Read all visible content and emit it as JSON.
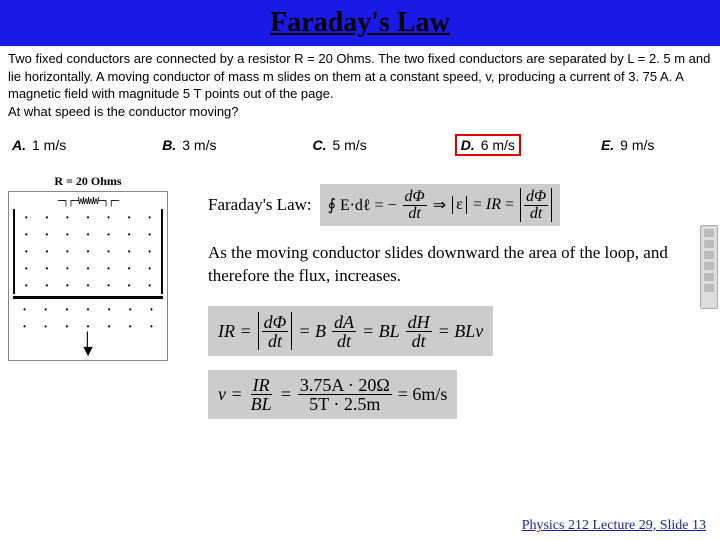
{
  "title": "Faraday's Law",
  "problem": {
    "p1": "Two fixed conductors are connected by a resistor R = 20 Ohms.  The two fixed conductors are separated by L = 2. 5 m and lie horizontally.  A moving conductor of mass m slides on them at a constant speed, v, producing a current of 3. 75 A.  A magnetic field with magnitude 5 T points out of the page.",
    "p2": "At what speed is the conductor moving?"
  },
  "answers": {
    "a": {
      "lbl": "A.",
      "txt": "1 m/s"
    },
    "b": {
      "lbl": "B.",
      "txt": "3 m/s"
    },
    "c": {
      "lbl": "C.",
      "txt": "5 m/s"
    },
    "d": {
      "lbl": "D.",
      "txt": "6 m/s"
    },
    "e": {
      "lbl": "E.",
      "txt": "9 m/s"
    }
  },
  "diagram": {
    "rlabel": "R = 20 Ohms"
  },
  "faraday": {
    "label": "Faraday's Law:",
    "eq1_lhs": "∮ E⋅dℓ = −",
    "eq1_num": "dΦ",
    "eq1_den": "dt",
    "eq1_arrow": "⇒",
    "eq1_rhs1": "|ε| = IR =",
    "eq1_rhs_num": "dΦ",
    "eq1_rhs_den": "dt"
  },
  "explain": "As the moving conductor slides downward the area of the loop, and therefore the flux, increases.",
  "eq2": {
    "p1": "IR =",
    "f1n": "dΦ",
    "f1d": "dt",
    "p2": "= B",
    "f2n": "dA",
    "f2d": "dt",
    "p3": "= BL",
    "f3n": "dH",
    "f3d": "dt",
    "p4": "= BLv"
  },
  "eq3": {
    "p1": "v =",
    "f1n": "IR",
    "f1d": "BL",
    "p2": "=",
    "f2n": "3.75A · 20Ω",
    "f2d": "5T · 2.5m",
    "p3": "= 6m/s"
  },
  "footer": "Physics 212  Lecture 29, Slide  13"
}
